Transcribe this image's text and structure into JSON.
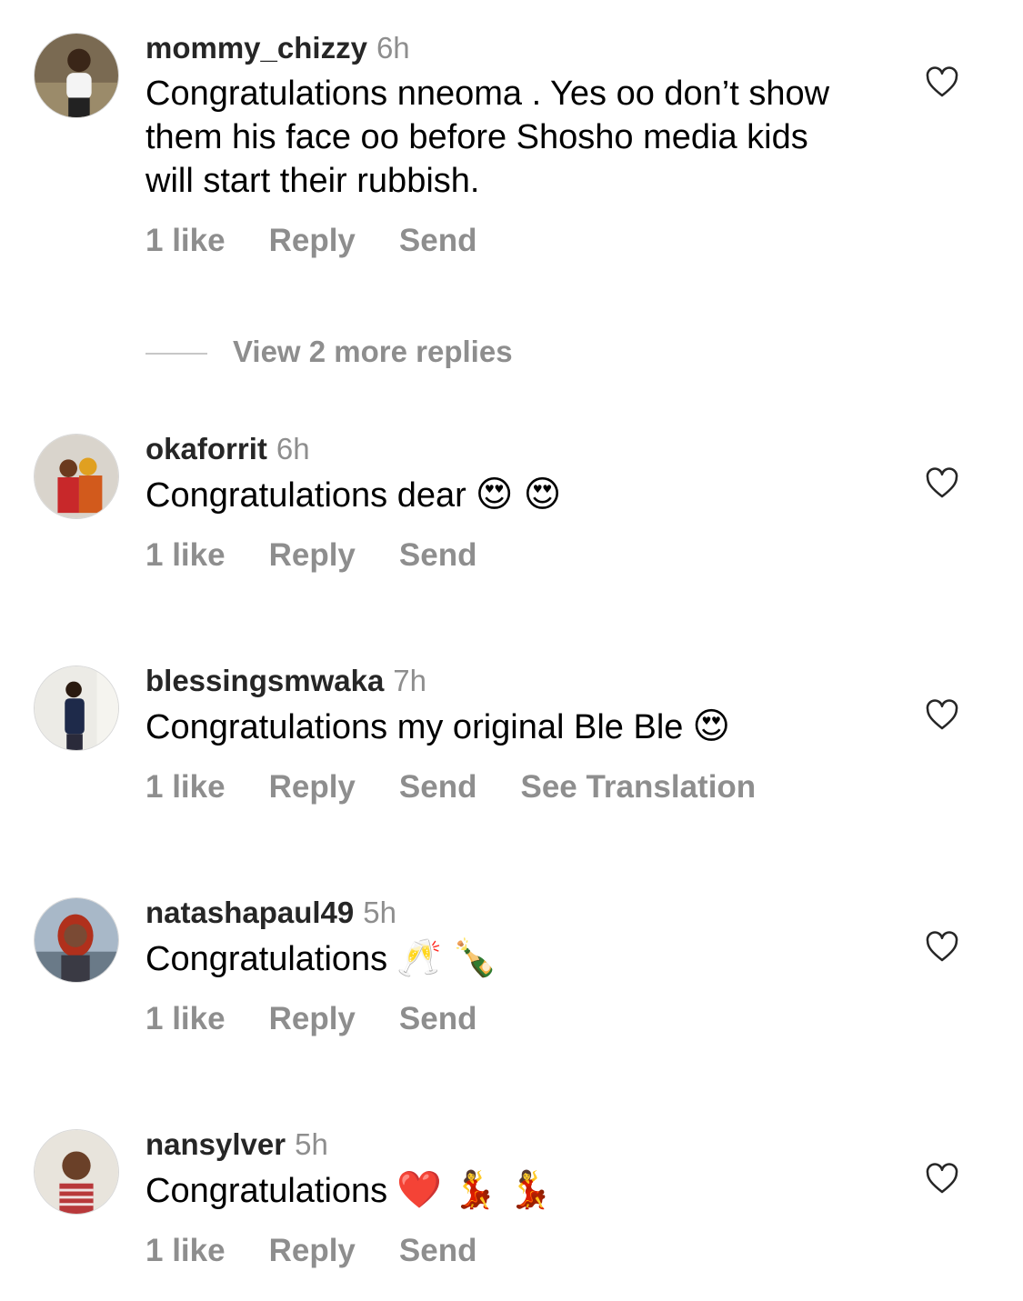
{
  "comments": [
    {
      "username": "mommy_chizzy",
      "time": "6h",
      "text": "Congratulations nneoma . Yes oo don’t show them his face oo before Shosho media kids will start their rubbish.",
      "likes": "1 like",
      "reply": "Reply",
      "send": "Send"
    },
    {
      "username": "okaforrit",
      "time": "6h",
      "text": "Congratulations dear",
      "emoji": "😍 😍",
      "likes": "1 like",
      "reply": "Reply",
      "send": "Send"
    },
    {
      "username": "blessingsmwaka",
      "time": "7h",
      "text": "Congratulations my original Ble Ble",
      "emoji": "😍",
      "likes": "1 like",
      "reply": "Reply",
      "send": "Send",
      "translate": "See Translation"
    },
    {
      "username": "natashapaul49",
      "time": "5h",
      "text": "Congratulations",
      "emoji": "🥂 🍾",
      "likes": "1 like",
      "reply": "Reply",
      "send": "Send"
    },
    {
      "username": "nansylver",
      "time": "5h",
      "text": "Congratulations",
      "emoji": "❤️ 💃 💃",
      "likes": "1 like",
      "reply": "Reply",
      "send": "Send"
    }
  ],
  "view_replies": "View 2 more replies",
  "colors": {
    "secondary_text": "#8e8e8e",
    "primary_text": "#262626",
    "divider": "#c7c7c7"
  },
  "icons": {
    "like": "heart-outline-icon"
  }
}
